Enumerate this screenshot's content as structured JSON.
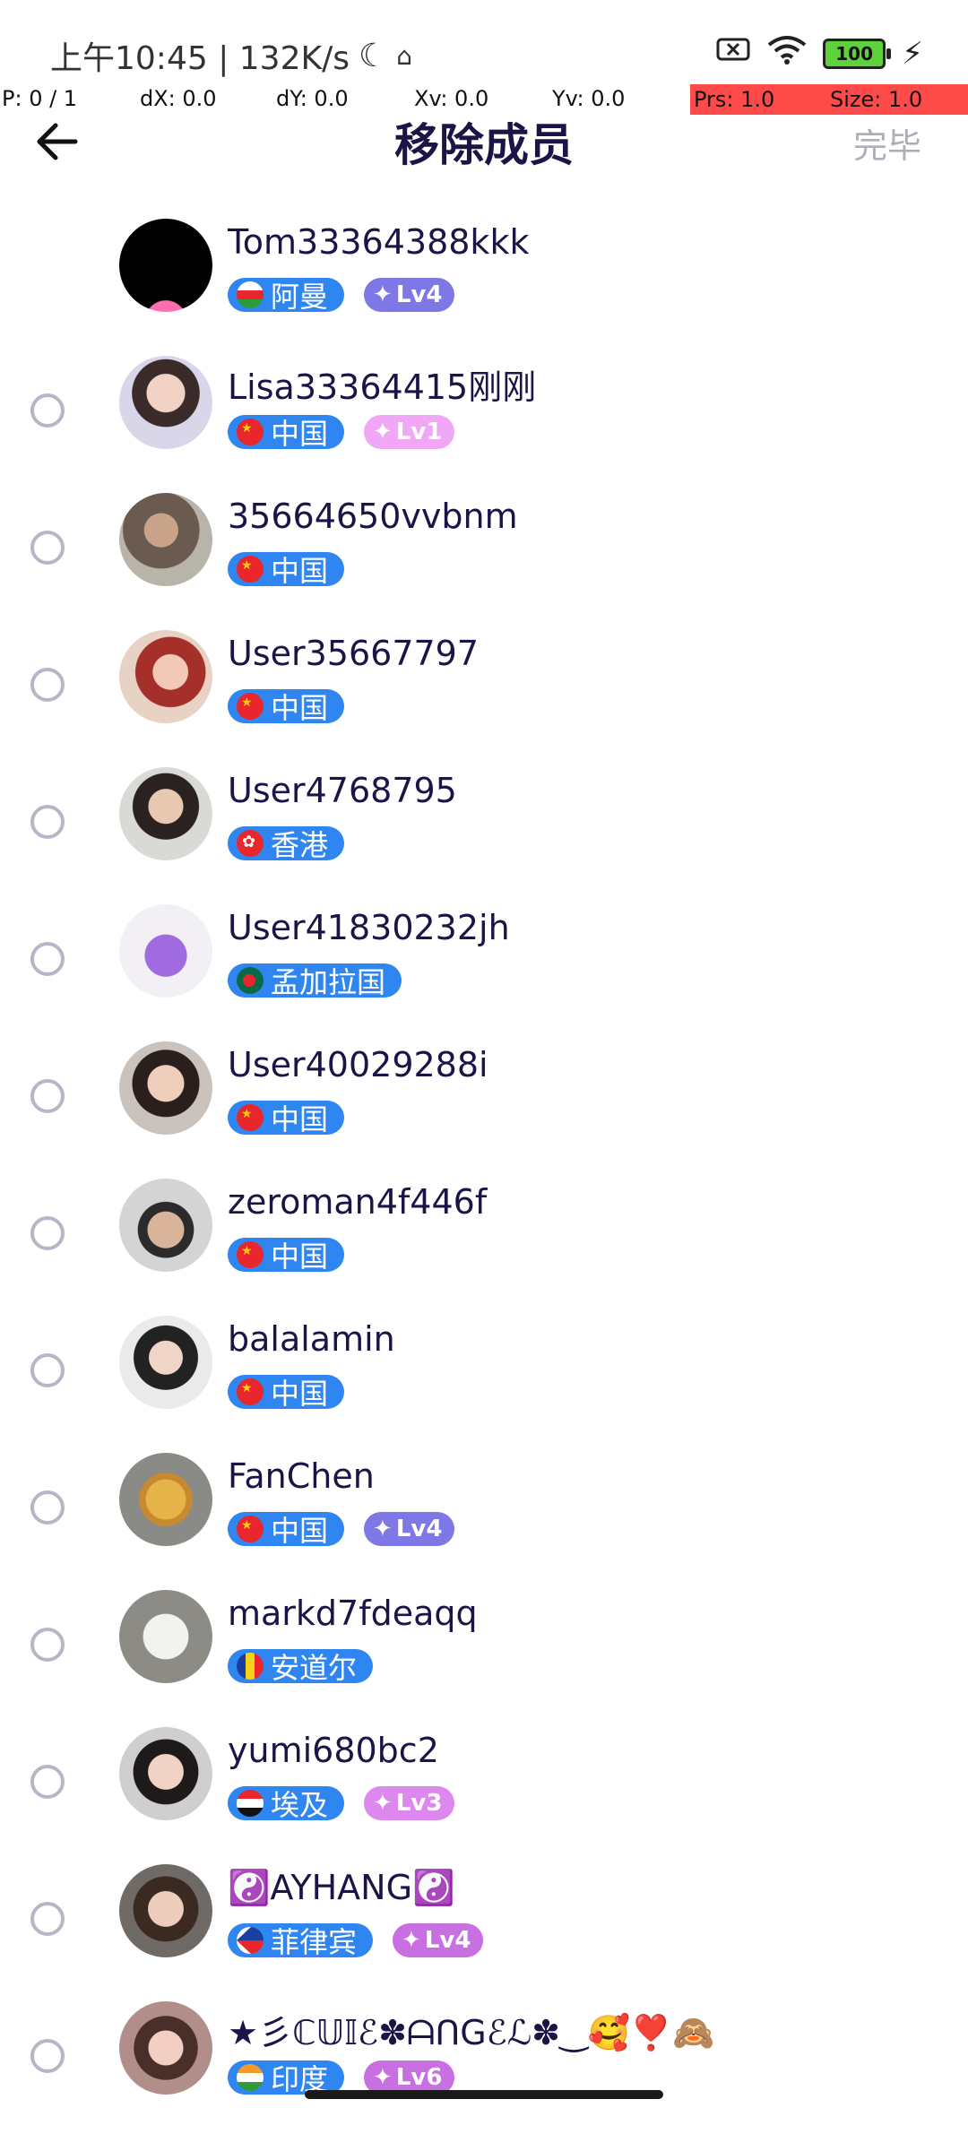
{
  "status_bar": {
    "time_text": "上午10:45 | 132K/s",
    "battery": "100"
  },
  "debug": {
    "p": "P: 0 / 1",
    "dx": "dX: 0.0",
    "dy": "dY: 0.0",
    "xv": "Xv: 0.0",
    "yv": "Yv: 0.0",
    "prs": "Prs: 1.0",
    "size": "Size: 1.0"
  },
  "header": {
    "title": "移除成员",
    "done_label": "完毕"
  },
  "colors": {
    "country_tag": "#2f86f0",
    "lv_blue": "#7d78e6",
    "lv_pink": "#dd88ee",
    "lv_pink2": "#c86fe2",
    "title": "#1c1446"
  },
  "members": [
    {
      "name": "Tom33364388kkk",
      "country": "阿曼",
      "flag": "flag-oman",
      "level": "Lv4",
      "level_color": "#7d78e6",
      "selectable": false,
      "avatar": "avatar-black"
    },
    {
      "name": "Lisa33364415刚刚",
      "country": "中国",
      "flag": "flag-china",
      "level": "Lv1",
      "level_color": "#f0a7f5",
      "selectable": true,
      "avatar": "avatar-girl"
    },
    {
      "name": "35664650vvbnm",
      "country": "中国",
      "flag": "flag-china",
      "level": "",
      "selectable": true,
      "avatar": "avatar-tattoo"
    },
    {
      "name": "User35667797",
      "country": "中国",
      "flag": "flag-china",
      "level": "",
      "selectable": true,
      "avatar": "avatar-redhair"
    },
    {
      "name": "User4768795",
      "country": "香港",
      "flag": "flag-hongkong",
      "level": "",
      "selectable": true,
      "avatar": "avatar-glasses"
    },
    {
      "name": "User41830232jh",
      "country": "孟加拉国",
      "flag": "flag-bangladesh",
      "level": "",
      "selectable": true,
      "avatar": "avatar-monster"
    },
    {
      "name": "User40029288i",
      "country": "中国",
      "flag": "flag-china",
      "level": "",
      "selectable": true,
      "avatar": "avatar-woman"
    },
    {
      "name": "zeroman4f446f",
      "country": "中国",
      "flag": "flag-china",
      "level": "",
      "selectable": true,
      "avatar": "avatar-man"
    },
    {
      "name": "balalamin",
      "country": "中国",
      "flag": "flag-china",
      "level": "",
      "selectable": true,
      "avatar": "avatar-shorthair"
    },
    {
      "name": "FanChen",
      "country": "中国",
      "flag": "flag-china",
      "level": "Lv4",
      "level_color": "#7d78e6",
      "selectable": true,
      "avatar": "avatar-cake"
    },
    {
      "name": "markd7fdeaqq",
      "country": "安道尔",
      "flag": "flag-andorra",
      "level": "",
      "selectable": true,
      "avatar": "avatar-mug"
    },
    {
      "name": "yumi680bc2",
      "country": "埃及",
      "flag": "flag-egypt",
      "level": "Lv3",
      "level_color": "#dd88ee",
      "selectable": true,
      "avatar": "avatar-yumi"
    },
    {
      "name": "☯️AYHANG☯️",
      "country": "菲律宾",
      "flag": "flag-philippines",
      "level": "Lv4",
      "level_color": "#c86fe2",
      "selectable": true,
      "avatar": "avatar-ayhang"
    },
    {
      "name": "★彡ℂ𝕌𝕀ℰ✽ᗩᑎGℰℒ✽‿🥰❣️🙈",
      "country": "印度",
      "flag": "flag-india",
      "level": "Lv6",
      "level_color": "#c86fe2",
      "selectable": true,
      "avatar": "avatar-cute"
    }
  ]
}
